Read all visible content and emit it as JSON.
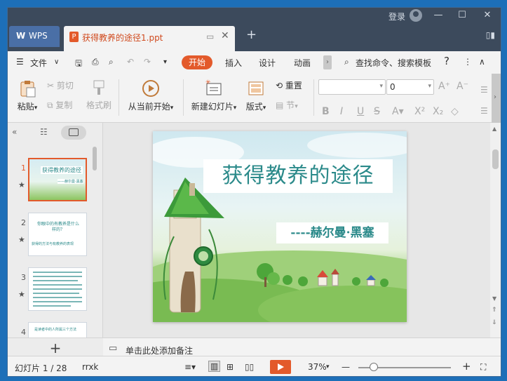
{
  "window": {
    "login_label": "登录",
    "minimize": "—",
    "maximize": "☐",
    "close": "✕"
  },
  "tabs": {
    "wps_label": "WPS",
    "doc_title": "获得教养的途径1.ppt",
    "doc_icon": "P",
    "add_tab": "+"
  },
  "menu": {
    "file": "文件",
    "start": "开始",
    "insert": "插入",
    "design": "设计",
    "animation": "动画",
    "search": "查找命令、搜索模板",
    "help": "?",
    "more": "⋮",
    "collapse": "∧"
  },
  "ribbon": {
    "paste": "粘贴",
    "cut": "剪切",
    "copy": "复制",
    "format_painter": "格式刷",
    "play_from_current": "从当前开始",
    "new_slide": "新建幻灯片",
    "layout": "版式",
    "reset": "重置",
    "section": "节",
    "font_name": "",
    "font_size": "0"
  },
  "slide": {
    "title": "获得教养的途径",
    "subtitle": "----赫尔曼·黑塞"
  },
  "thumbnails": [
    {
      "num": "1",
      "selected": true,
      "text": "获得教养的途径",
      "sub": "——赫尔曼·黑塞"
    },
    {
      "num": "2",
      "selected": false,
      "text": "你眼中的有教养是什么样的？",
      "sub": "获得的方法与有教养的表现"
    },
    {
      "num": "3",
      "selected": false,
      "text": "",
      "sub": ""
    },
    {
      "num": "4",
      "selected": false,
      "text": "是读者中的人所属三个方法",
      "sub": ""
    }
  ],
  "notes": {
    "placeholder": "单击此处添加备注"
  },
  "status": {
    "slide_counter": "幻灯片 1 / 28",
    "author": "rrxk",
    "zoom": "37%",
    "zoom_minus": "—",
    "zoom_plus": "+"
  },
  "colors": {
    "accent": "#e35a2b",
    "titlebar": "#3c4a5c",
    "slide_title": "#2b8a8a"
  }
}
